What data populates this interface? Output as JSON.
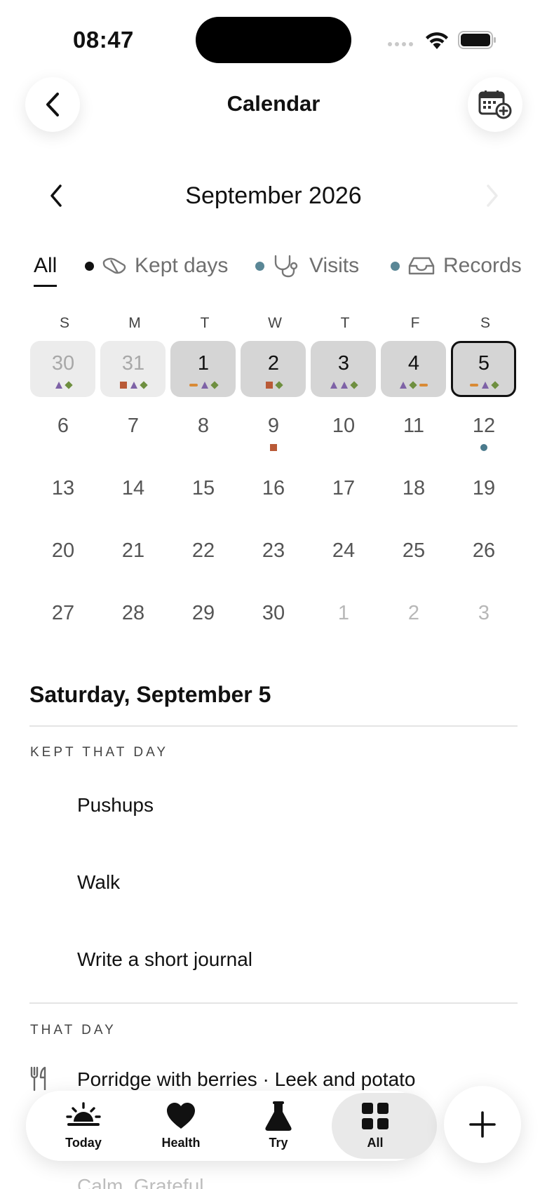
{
  "status_bar": {
    "time": "08:47"
  },
  "header": {
    "title": "Calendar"
  },
  "month_nav": {
    "title": "September 2026"
  },
  "filters": {
    "all": "All",
    "kept_days": "Kept days",
    "visits": "Visits",
    "records": "Records",
    "colors": {
      "kept": "#111111",
      "visits": "#4a7a8c",
      "records": "#4a7a8c"
    }
  },
  "weekdays": [
    "S",
    "M",
    "T",
    "W",
    "T",
    "F",
    "S"
  ],
  "weeks": [
    [
      {
        "n": "30",
        "kind": "prev",
        "marks": [
          "tri",
          "dia"
        ]
      },
      {
        "n": "31",
        "kind": "prev",
        "marks": [
          "sq",
          "tri",
          "dia"
        ]
      },
      {
        "n": "1",
        "kind": "cur",
        "marks": [
          "dash",
          "tri",
          "dia"
        ]
      },
      {
        "n": "2",
        "kind": "cur",
        "marks": [
          "sq",
          "dia"
        ]
      },
      {
        "n": "3",
        "kind": "cur",
        "marks": [
          "tri",
          "tri",
          "dia"
        ]
      },
      {
        "n": "4",
        "kind": "cur",
        "marks": [
          "tri",
          "dia",
          "dash"
        ]
      },
      {
        "n": "5",
        "kind": "sel",
        "marks": [
          "dash",
          "tri",
          "dia"
        ]
      }
    ],
    [
      {
        "n": "6",
        "kind": "plain",
        "marks": []
      },
      {
        "n": "7",
        "kind": "plain",
        "marks": []
      },
      {
        "n": "8",
        "kind": "plain",
        "marks": []
      },
      {
        "n": "9",
        "kind": "plain",
        "marks": [
          "sq"
        ]
      },
      {
        "n": "10",
        "kind": "plain",
        "marks": []
      },
      {
        "n": "11",
        "kind": "plain",
        "marks": []
      },
      {
        "n": "12",
        "kind": "plain",
        "marks": [
          "dot"
        ]
      }
    ],
    [
      {
        "n": "13",
        "kind": "plain",
        "marks": []
      },
      {
        "n": "14",
        "kind": "plain",
        "marks": []
      },
      {
        "n": "15",
        "kind": "plain",
        "marks": []
      },
      {
        "n": "16",
        "kind": "plain",
        "marks": []
      },
      {
        "n": "17",
        "kind": "plain",
        "marks": []
      },
      {
        "n": "18",
        "kind": "plain",
        "marks": []
      },
      {
        "n": "19",
        "kind": "plain",
        "marks": []
      }
    ],
    [
      {
        "n": "20",
        "kind": "plain",
        "marks": []
      },
      {
        "n": "21",
        "kind": "plain",
        "marks": []
      },
      {
        "n": "22",
        "kind": "plain",
        "marks": []
      },
      {
        "n": "23",
        "kind": "plain",
        "marks": []
      },
      {
        "n": "24",
        "kind": "plain",
        "marks": []
      },
      {
        "n": "25",
        "kind": "plain",
        "marks": []
      },
      {
        "n": "26",
        "kind": "plain",
        "marks": []
      }
    ],
    [
      {
        "n": "27",
        "kind": "plain",
        "marks": []
      },
      {
        "n": "28",
        "kind": "plain",
        "marks": []
      },
      {
        "n": "29",
        "kind": "plain",
        "marks": []
      },
      {
        "n": "30",
        "kind": "plain",
        "marks": []
      },
      {
        "n": "1",
        "kind": "next",
        "marks": []
      },
      {
        "n": "2",
        "kind": "next",
        "marks": []
      },
      {
        "n": "3",
        "kind": "next",
        "marks": []
      }
    ]
  ],
  "detail": {
    "title": "Saturday, September 5",
    "kept_label": "KEPT THAT DAY",
    "kept_items": [
      "Pushups",
      "Walk",
      "Write a short journal"
    ],
    "that_day_label": "THAT DAY",
    "that_day_meal": "Porridge with berries · Leek and potato",
    "that_day_next": "Calm, Grateful"
  },
  "tabs": [
    {
      "label": "Today",
      "icon": "sunrise-icon"
    },
    {
      "label": "Health",
      "icon": "heart-icon"
    },
    {
      "label": "Try",
      "icon": "flask-icon"
    },
    {
      "label": "All",
      "icon": "grid-icon"
    }
  ]
}
